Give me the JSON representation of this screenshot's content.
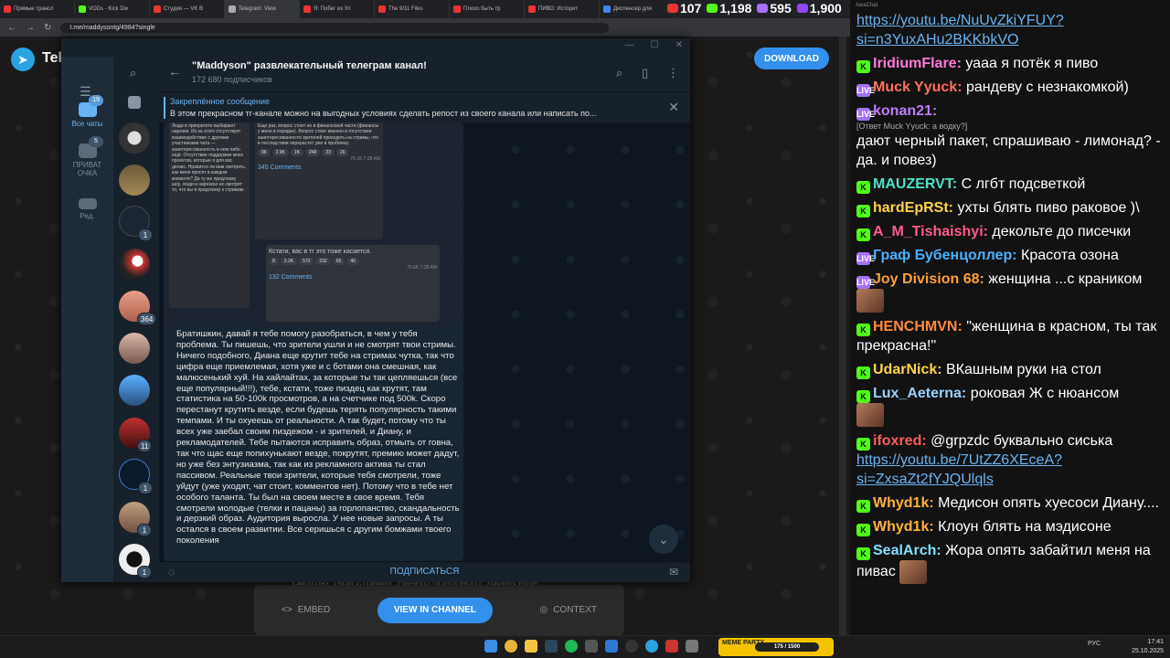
{
  "browser": {
    "tabs": [
      {
        "label": "Прямые трансл",
        "color": "#e33"
      },
      {
        "label": "VODs - Kick Dw",
        "color": "#53fc18"
      },
      {
        "label": "Студия — VK В",
        "color": "#e33"
      },
      {
        "label": "Telegram: View",
        "color": "#aaa"
      },
      {
        "label": "Я: Побег из Ул",
        "color": "#e33"
      },
      {
        "label": "The 9/11 Files",
        "color": "#e33"
      },
      {
        "label": "Плохо быть тр",
        "color": "#e33"
      },
      {
        "label": "ПИВО: Историт",
        "color": "#e33"
      },
      {
        "label": "Диспенсер для",
        "color": "#4285f4"
      }
    ],
    "url": "t.me/maddysontg/4984?single"
  },
  "stats": {
    "first": "107",
    "second": "1,198",
    "third": "595",
    "fourth": "1,900"
  },
  "web": {
    "brand": "Tele",
    "download": "DOWNLOAD",
    "embed": "EMBED",
    "view_in_channel": "VIEW IN CHANNEL",
    "context": "CONTEXT",
    "bg_text": "смотрят твои стримы. Ничего подобного, Диана еще"
  },
  "tg": {
    "rail": {
      "all_chats": "Все чаты",
      "all_badge": "19",
      "private": "ПРИВАТ ОЧКА",
      "private_badge": "5",
      "edit": "Ред."
    },
    "chat_badges": [
      "1",
      "364",
      "11",
      "1",
      "1",
      "1"
    ],
    "channel_title": "\"Maddyson\" развлекательный телеграм канал!",
    "subscribers": "172 680 подписчиков",
    "pinned_title": "Закреплённое сообщение",
    "pinned_text": "В этом прекрасном тг-канале можно на выгодных условиях сделать репост из своего канала или написать по...",
    "screenshot": {
      "left_text": "Люди в приоритете выбирают нарезки. Из-за этого отсутствует взаимодействие с другими участниками чата — заинтересованность в нем либо ещё. Отсутствие поддержки моих проектов, которые я для вас делаю. Нравится ли вам смотреть, как меня просят в каждом моменте? Да ту же предложку шоу, люди в нарезках не смотрят то, что вы в предложку к стримам.",
      "mid_text": "Еще раз, вопрос стоит не в финансовой части (финансы у меня в порядке). Вопрос стоит именно в отсутствии заинтересованности зрителей приходить на стримы, что в последствии перерастет уже в проблему.",
      "mid_reactions": [
        "96",
        "2.9K",
        "1K",
        "248",
        "23",
        "26"
      ],
      "mid_views": "76.1K 7:28 AM",
      "mid_comments": "345 Comments",
      "right_text": "Кстати, вас в тг это тоже касается.",
      "right_reactions": [
        "8",
        "3.2K",
        "572",
        "232",
        "65",
        "40"
      ],
      "right_views": "76.6K 7:28 AM",
      "right_comments": "132 Comments"
    },
    "message": "Братишкин, давай я тебе помогу разобраться, в чем у тебя проблема. Ты пишешь, что зрители ушли и не смотрят твои стримы. Ничего подобного, Диана еще крутит тебе на стримах чутка, так что цифра еще приемлемая, хотя уже и с ботами она смешная, как малюсенький хуй. На хайлайтах, за которые ты так цепляешься (все еще популярный!!!), тебе, кстати, тоже пиздец как крутят, там статистика на 50-100k просмотров, а на счетчике под 500k. Скоро перестанут крутить везде, если будешь терять популярность такими темпами. И ты охуеешь от реальности. А так будет, потому что ты всех уже заебал своим пиздежом - и зрителей, и Диану, и рекламодателей. Тебе пытаются исправить образ, отмыть от говна, так что щас еще попихунькают везде, покрутят, премию может дадут, но уже без энтузиазма, так как из рекламного актива ты стал пассивом. Реальные твои зрители, которые тебя смотрели, тоже уйдут (уже уходят, чат стоит, комментов нет). Потому что в тебе нет особого таланта. Ты был на своем месте в свое время.  Тебя смотрели молодые (телки и пацаны) за горлопанство, скандальность и дерзкий образ. Аудитория выросла. У нее новые запросы. А ты остался в своем развитии. Все серишься с другим бомжами твоего поколения",
    "subscribe": "ПОДПИСАТЬСЯ"
  },
  "chat": {
    "title": "AwaChat",
    "messages": [
      {
        "badge": "",
        "nick": "",
        "nick_color": "#ffffff",
        "text": "",
        "link": "https://youtu.be/NuUvZkiYFUY?si=n3YuxAHu2BKKbkVO",
        "reply": ""
      },
      {
        "badge": "K",
        "nick": "IridiumFlare:",
        "nick_color": "#ff7ad9",
        "text": "уааа я потёк я пиво",
        "link": "",
        "reply": ""
      },
      {
        "badge": "LIVE",
        "nick": "Muck Yyuck:",
        "nick_color": "#ff6f61",
        "text": "рандеву с незнакомкой)",
        "link": "",
        "reply": ""
      },
      {
        "badge": "LIVE",
        "nick": "konan21:",
        "nick_color": "#c07cff",
        "text": "дают черный пакет, спрашиваю - лимонад? - да. и повез)",
        "link": "",
        "reply": "[Ответ Muck Yyuck: а водку?]"
      },
      {
        "badge": "K",
        "nick": "MAUZERVT:",
        "nick_color": "#4ee0c7",
        "text": "С лгбт подсветкой",
        "link": "",
        "reply": ""
      },
      {
        "badge": "K",
        "nick": "hardEpRSt:",
        "nick_color": "#ffd24a",
        "text": "ухты блять пиво раковое )\\",
        "link": "",
        "reply": ""
      },
      {
        "badge": "K",
        "nick": "A_M_Tishaishyi:",
        "nick_color": "#ff5c8a",
        "text": "декольте до писечки",
        "link": "",
        "reply": ""
      },
      {
        "badge": "LIVE",
        "nick": "Граф Бубенцоллер:",
        "nick_color": "#4ab0ff",
        "text": "Красота озона",
        "link": "",
        "reply": ""
      },
      {
        "badge": "LIVE",
        "nick": "Joy Division 68:",
        "nick_color": "#ff9e3d",
        "text": "женщина ...с краником",
        "link": "",
        "reply": ""
      },
      {
        "badge": "K",
        "nick": "HENCHMVN:",
        "nick_color": "#ff8a3d",
        "text": "\"женщина в красном, ты так прекрасна!\"",
        "link": "",
        "reply": ""
      },
      {
        "badge": "K",
        "nick": "UdarNick:",
        "nick_color": "#ffd24a",
        "text": "ВКашным руки на стол",
        "link": "",
        "reply": ""
      },
      {
        "badge": "K",
        "nick": "Lux_Aeterna:",
        "nick_color": "#9ad0ff",
        "text": "роковая Ж с нюансом",
        "link": "",
        "reply": ""
      },
      {
        "badge": "K",
        "nick": "ifoxred:",
        "nick_color": "#ff5c5c",
        "text": "@grpzdc буквально сиська",
        "link": "https://youtu.be/7UtZZ6XEceA?si=ZxsaZt2fYJQUlqls",
        "reply": ""
      },
      {
        "badge": "K",
        "nick": "Whyd1k:",
        "nick_color": "#ffb13d",
        "text": "Медисон опять хуесоси Диану....",
        "link": "",
        "reply": ""
      },
      {
        "badge": "K",
        "nick": "Whyd1k:",
        "nick_color": "#ffb13d",
        "text": "Клоун блять на мэдисоне",
        "link": "",
        "reply": ""
      },
      {
        "badge": "K",
        "nick": "SealArch:",
        "nick_color": "#7fe0ff",
        "text": "Жора опять забайтил меня на пивас",
        "link": "",
        "reply": ""
      }
    ]
  },
  "taskbar": {
    "meme_title": "MEME PARTY",
    "meme_progress": "175 / 1500",
    "lang": "РУС",
    "time": "17:41",
    "date": "25.10.2025"
  }
}
